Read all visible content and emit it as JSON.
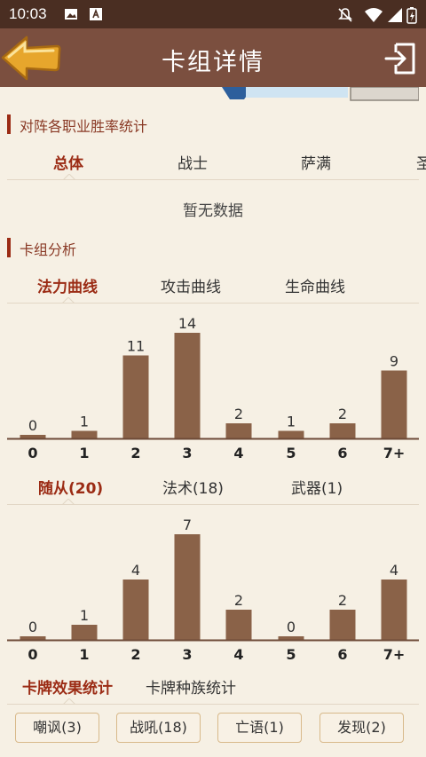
{
  "status_bar": {
    "time": "10:03"
  },
  "header": {
    "title": "卡组详情"
  },
  "winrate_section": {
    "title": "对阵各职业胜率统计",
    "tabs": [
      "总体",
      "战士",
      "萨满",
      "圣"
    ],
    "empty_text": "暂无数据"
  },
  "analysis_section": {
    "title": "卡组分析",
    "curve_tabs": [
      "法力曲线",
      "攻击曲线",
      "生命曲线"
    ]
  },
  "type_tabs": [
    "随从(20)",
    "法术(18)",
    "武器(1)"
  ],
  "effect_tabs": [
    "卡牌效果统计",
    "卡牌种族统计"
  ],
  "effect_pills": [
    "嘲讽(3)",
    "战吼(18)",
    "亡语(1)",
    "发现(2)"
  ],
  "colors": {
    "bar": "#8a6248",
    "accent": "#9b2b14",
    "header": "#7b4f3f",
    "status": "#4a2e22"
  },
  "chart_data": [
    {
      "type": "bar",
      "categories": [
        "0",
        "1",
        "2",
        "3",
        "4",
        "5",
        "6",
        "7+"
      ],
      "values": [
        0,
        1,
        11,
        14,
        2,
        1,
        2,
        9
      ],
      "ylim": [
        0,
        14
      ]
    },
    {
      "type": "bar",
      "categories": [
        "0",
        "1",
        "2",
        "3",
        "4",
        "5",
        "6",
        "7+"
      ],
      "values": [
        0,
        1,
        4,
        7,
        2,
        0,
        2,
        4
      ],
      "ylim": [
        0,
        7
      ]
    }
  ]
}
